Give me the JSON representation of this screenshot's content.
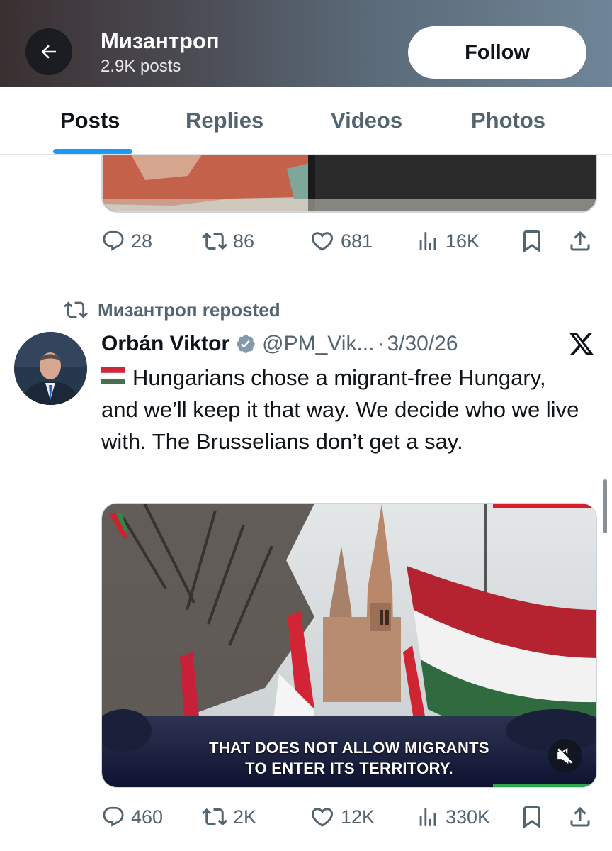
{
  "header": {
    "title": "Мизантроп",
    "posts_count": "2.9K posts",
    "follow_label": "Follow",
    "back_icon": "arrow-left-icon"
  },
  "tabs": [
    {
      "label": "Posts",
      "active": true
    },
    {
      "label": "Replies",
      "active": false
    },
    {
      "label": "Videos",
      "active": false
    },
    {
      "label": "Photos",
      "active": false
    }
  ],
  "first_post": {
    "stats": {
      "replies": "28",
      "reposts": "86",
      "likes": "681",
      "views": "16K"
    }
  },
  "second_post": {
    "repost_label": "Мизантроп reposted",
    "author_name": "Orbán Viktor",
    "handle": "@PM_Vik...",
    "separator": "·",
    "date": "3/30/26",
    "verified": true,
    "text": "Hungarians chose a migrant-free Hungary, and we’ll keep it that way. We decide who we live with. The Brusselians don’t get a say.",
    "video_caption_line1": "THAT DOES NOT ALLOW MIGRANTS",
    "video_caption_line2": "TO ENTER ITS TERRITORY.",
    "stats": {
      "replies": "460",
      "reposts": "2K",
      "likes": "12K",
      "views": "330K"
    }
  },
  "colors": {
    "accent": "#1d9bf0",
    "secondary_text": "#536471",
    "primary_text": "#0f1419",
    "flag_red": "#ce2939",
    "flag_white": "#ffffff",
    "flag_green": "#477050"
  }
}
